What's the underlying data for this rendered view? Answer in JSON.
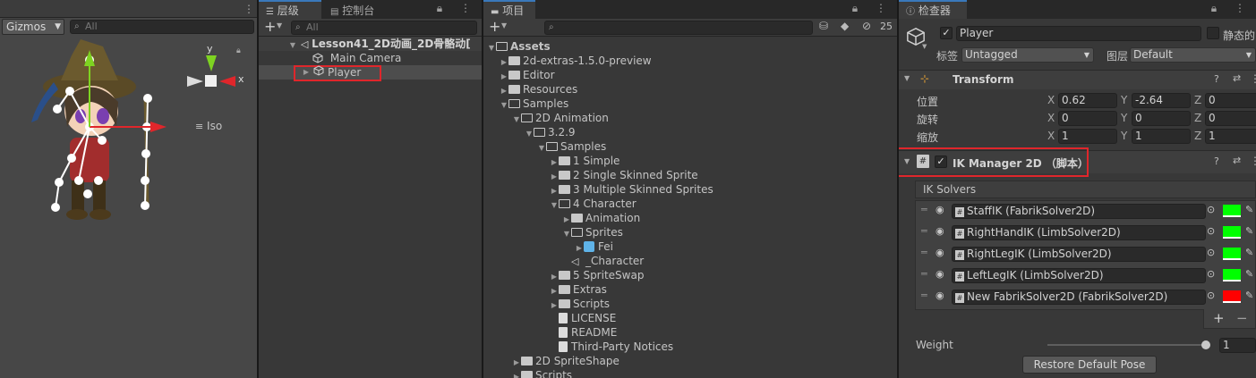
{
  "scene": {
    "gizmos_label": "Gizmos",
    "search_placeholder": "All",
    "iso_label": "Iso",
    "axis_y": "y",
    "axis_x": "x"
  },
  "hierarchy": {
    "tab_label": "层级",
    "console_tab_label": "控制台",
    "search_placeholder": "All",
    "scene_name": "Lesson41_2D动画_2D骨骼动[",
    "items": [
      {
        "label": "Main Camera"
      },
      {
        "label": "Player"
      }
    ],
    "add_label": "+"
  },
  "project": {
    "tab_label": "项目",
    "add_label": "+",
    "search_placeholder": "",
    "hidden_count": "25",
    "tree": [
      {
        "label": "Assets",
        "depth": 0,
        "arrow": "open",
        "icon": "folder-open-icon",
        "bold": true
      },
      {
        "label": "2d-extras-1.5.0-preview",
        "depth": 1,
        "arrow": "closed",
        "icon": "folder-icon"
      },
      {
        "label": "Editor",
        "depth": 1,
        "arrow": "closed",
        "icon": "folder-icon"
      },
      {
        "label": "Resources",
        "depth": 1,
        "arrow": "closed",
        "icon": "folder-icon"
      },
      {
        "label": "Samples",
        "depth": 1,
        "arrow": "open",
        "icon": "folder-open-icon"
      },
      {
        "label": "2D Animation",
        "depth": 2,
        "arrow": "open",
        "icon": "folder-open-icon"
      },
      {
        "label": "3.2.9",
        "depth": 3,
        "arrow": "open",
        "icon": "folder-open-icon"
      },
      {
        "label": "Samples",
        "depth": 4,
        "arrow": "open",
        "icon": "folder-open-icon"
      },
      {
        "label": "1 Simple",
        "depth": 5,
        "arrow": "closed",
        "icon": "folder-icon"
      },
      {
        "label": "2 Single Skinned Sprite",
        "depth": 5,
        "arrow": "closed",
        "icon": "folder-icon"
      },
      {
        "label": "3 Multiple Skinned Sprites",
        "depth": 5,
        "arrow": "closed",
        "icon": "folder-icon"
      },
      {
        "label": "4 Character",
        "depth": 5,
        "arrow": "open",
        "icon": "folder-open-icon"
      },
      {
        "label": "Animation",
        "depth": 6,
        "arrow": "closed",
        "icon": "folder-icon"
      },
      {
        "label": "Sprites",
        "depth": 6,
        "arrow": "open",
        "icon": "folder-open-icon"
      },
      {
        "label": "Fei",
        "depth": 7,
        "arrow": "closed",
        "icon": "prefab-icon"
      },
      {
        "label": "_Character",
        "depth": 6,
        "arrow": "none",
        "icon": "unity-scene-icon"
      },
      {
        "label": "5 SpriteSwap",
        "depth": 5,
        "arrow": "closed",
        "icon": "folder-icon"
      },
      {
        "label": "Extras",
        "depth": 5,
        "arrow": "closed",
        "icon": "folder-icon"
      },
      {
        "label": "Scripts",
        "depth": 5,
        "arrow": "closed",
        "icon": "folder-icon"
      },
      {
        "label": "LICENSE",
        "depth": 5,
        "arrow": "none",
        "icon": "file-icon"
      },
      {
        "label": "README",
        "depth": 5,
        "arrow": "none",
        "icon": "file-icon"
      },
      {
        "label": "Third-Party Notices",
        "depth": 5,
        "arrow": "none",
        "icon": "file-icon"
      },
      {
        "label": "2D SpriteShape",
        "depth": 2,
        "arrow": "closed",
        "icon": "folder-icon"
      },
      {
        "label": "Scripts",
        "depth": 2,
        "arrow": "closed",
        "icon": "folder-icon"
      }
    ]
  },
  "inspector": {
    "tab_label": "检查器",
    "object_name": "Player",
    "static_label": "静态的",
    "tag_label": "标签",
    "tag_value": "Untagged",
    "layer_label": "图层",
    "layer_value": "Default",
    "transform": {
      "title": "Transform",
      "rows": [
        {
          "label": "位置",
          "x": "0.62",
          "y": "-2.64",
          "z": "0"
        },
        {
          "label": "旋转",
          "x": "0",
          "y": "0",
          "z": "0"
        },
        {
          "label": "缩放",
          "x": "1",
          "y": "1",
          "z": "1"
        }
      ],
      "axis_x": "X",
      "axis_y": "Y",
      "axis_z": "Z"
    },
    "ik_manager": {
      "title": "IK Manager 2D （脚本）",
      "solvers_label": "IK Solvers",
      "solvers": [
        {
          "label": "StaffIK (FabrikSolver2D)",
          "color": "#00ff00"
        },
        {
          "label": "RightHandIK (LimbSolver2D)",
          "color": "#00ff00"
        },
        {
          "label": "RightLegIK (LimbSolver2D)",
          "color": "#00ff00"
        },
        {
          "label": "LeftLegIK (LimbSolver2D)",
          "color": "#00ff00"
        },
        {
          "label": "New FabrikSolver2D (FabrikSolver2D)",
          "color": "#ff0000"
        }
      ],
      "add_label": "+",
      "remove_label": "−",
      "weight_label": "Weight",
      "weight_value": "1",
      "weight_fraction": 1.0,
      "restore_label": "Restore Default Pose"
    }
  },
  "colors": {
    "highlight_red": "#e0262b",
    "accent_blue": "#3a79bb",
    "panel_bg": "#383838"
  }
}
